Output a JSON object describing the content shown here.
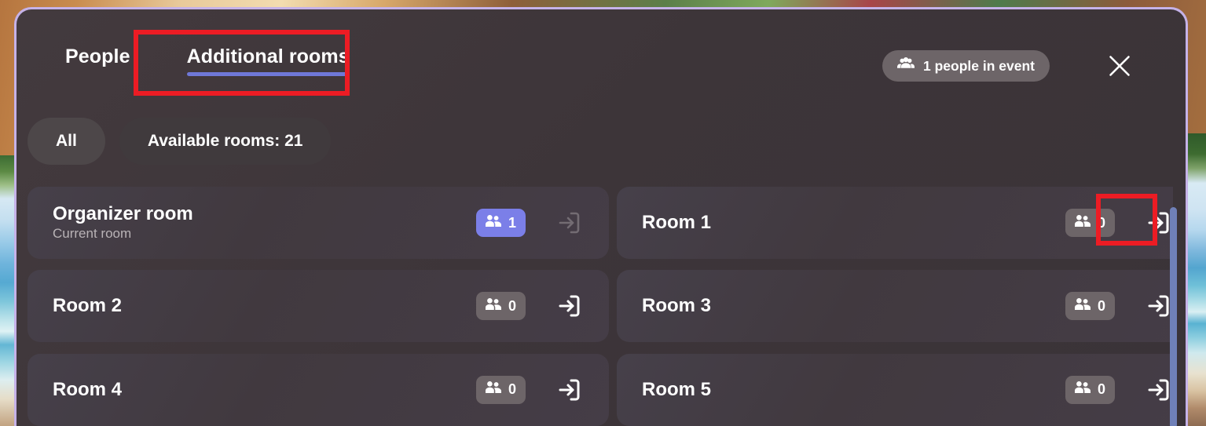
{
  "header": {
    "tabs": [
      {
        "label": "People",
        "active": false,
        "name": "tab-people"
      },
      {
        "label": "Additional rooms",
        "active": true,
        "name": "tab-additional-rooms"
      }
    ],
    "people_badge": {
      "icon": "people-group-icon",
      "label": "1 people in event"
    },
    "close_icon": "close-icon"
  },
  "filters": [
    {
      "label": "All",
      "selected": true,
      "name": "filter-chip-all"
    },
    {
      "label": "Available rooms: 21",
      "selected": false,
      "name": "filter-chip-available-rooms"
    }
  ],
  "rooms": [
    {
      "name": "Organizer room",
      "subtitle": "Current room",
      "count": "1",
      "count_style": "highlight",
      "join_enabled": false,
      "join_icon": "sign-in-icon"
    },
    {
      "name": "Room 1",
      "subtitle": "",
      "count": "0",
      "count_style": "plain",
      "join_enabled": true,
      "join_icon": "sign-in-icon"
    },
    {
      "name": "Room 2",
      "subtitle": "",
      "count": "0",
      "count_style": "plain",
      "join_enabled": true,
      "join_icon": "sign-in-icon"
    },
    {
      "name": "Room 3",
      "subtitle": "",
      "count": "0",
      "count_style": "plain",
      "join_enabled": true,
      "join_icon": "sign-in-icon"
    },
    {
      "name": "Room 4",
      "subtitle": "",
      "count": "0",
      "count_style": "plain",
      "join_enabled": true,
      "join_icon": "sign-in-icon"
    },
    {
      "name": "Room 5",
      "subtitle": "",
      "count": "0",
      "count_style": "plain",
      "join_enabled": true,
      "join_icon": "sign-in-icon"
    }
  ],
  "colors": {
    "panel_background": "#3d3539",
    "panel_border": "#c5b2e8",
    "tab_underline": "#6f78d8",
    "count_badge_highlight": "#7b7fe8",
    "count_badge_plain": "#6d6568",
    "chip_selected": "#4d4749",
    "chip_normal": "#403a3d",
    "card_background": "#433b41",
    "scrollbar_thumb": "#6f80b8",
    "annotation": "#ec1c24",
    "text_primary": "#ffffff",
    "text_secondary": "#b9b3b6"
  },
  "annotations": [
    {
      "target": "tab-additional-rooms",
      "name": "annotation-box-tab"
    },
    {
      "target": "join-button-room-1",
      "name": "annotation-box-join"
    }
  ]
}
